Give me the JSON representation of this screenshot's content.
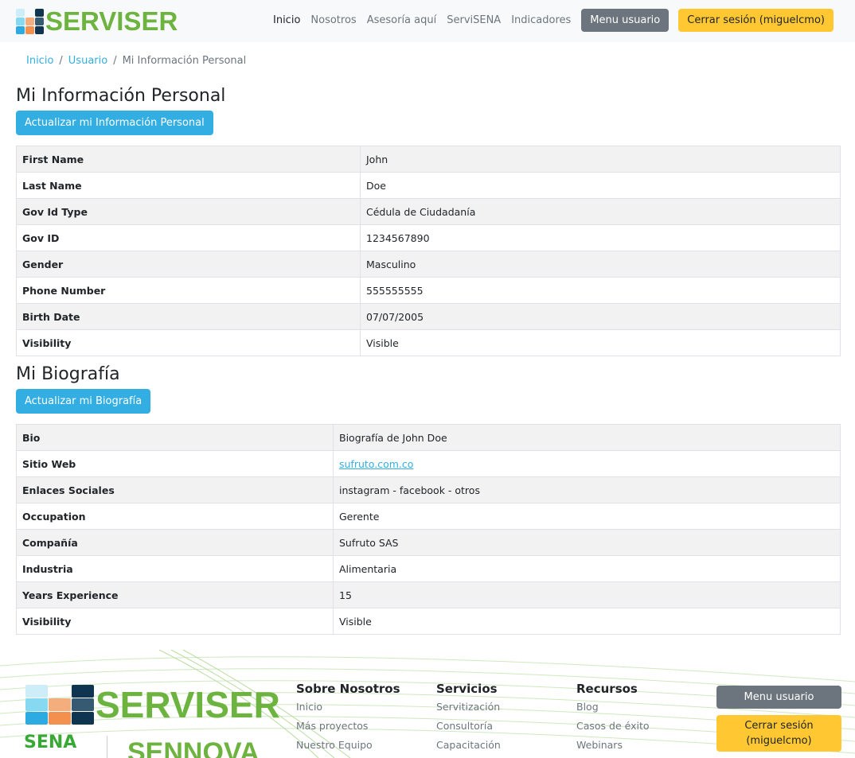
{
  "brand": "SERVISER",
  "nav": {
    "links": [
      "Inicio",
      "Nosotros",
      "Asesoría aquí",
      "ServiSENA",
      "Indicadores"
    ],
    "menu_user": "Menu usuario",
    "logout": "Cerrar sesión (miguelcmo)"
  },
  "breadcrumb": [
    "Inicio",
    "Usuario",
    "Mi Información Personal"
  ],
  "personal": {
    "title": "Mi Información Personal",
    "update": "Actualizar mi Información Personal",
    "rows": [
      [
        "First Name",
        "John"
      ],
      [
        "Last Name",
        "Doe"
      ],
      [
        "Gov Id Type",
        "Cédula de Ciudadanía"
      ],
      [
        "Gov ID",
        "1234567890"
      ],
      [
        "Gender",
        "Masculino"
      ],
      [
        "Phone Number",
        "555555555"
      ],
      [
        "Birth Date",
        "07/07/2005"
      ],
      [
        "Visibility",
        "Visible"
      ]
    ]
  },
  "bio": {
    "title": "Mi Biografía",
    "update": "Actualizar mi Biografía",
    "rows": [
      [
        "Bio",
        "Biografía de John Doe"
      ],
      [
        "Sitio Web",
        "sufruto.com.co"
      ],
      [
        "Enlaces Sociales",
        "instagram - facebook - otros"
      ],
      [
        "Occupation",
        "Gerente"
      ],
      [
        "Compañía",
        "Sufruto SAS"
      ],
      [
        "Industria",
        "Alimentaria"
      ],
      [
        "Years Experience",
        "15"
      ],
      [
        "Visibility",
        "Visible"
      ]
    ]
  },
  "footer": {
    "sena": "SENA",
    "sennova": "SENNOVA",
    "columns": [
      {
        "title": "Sobre Nosotros",
        "links": [
          "Inicio",
          "Más proyectos",
          "Nuestro Equipo"
        ]
      },
      {
        "title": "Servicios",
        "links": [
          "Servitización",
          "Consultoría",
          "Capacitación"
        ]
      },
      {
        "title": "Recursos",
        "links": [
          "Blog",
          "Casos de éxito",
          "Webinars"
        ]
      }
    ],
    "menu_user": "Menu usuario",
    "logout": "Cerrar sesión (miguelcmo)"
  },
  "colors": {
    "brand_green": "#6db33f",
    "primary": "#33aee3",
    "warning": "#ffc832",
    "secondary": "#6c757d"
  }
}
